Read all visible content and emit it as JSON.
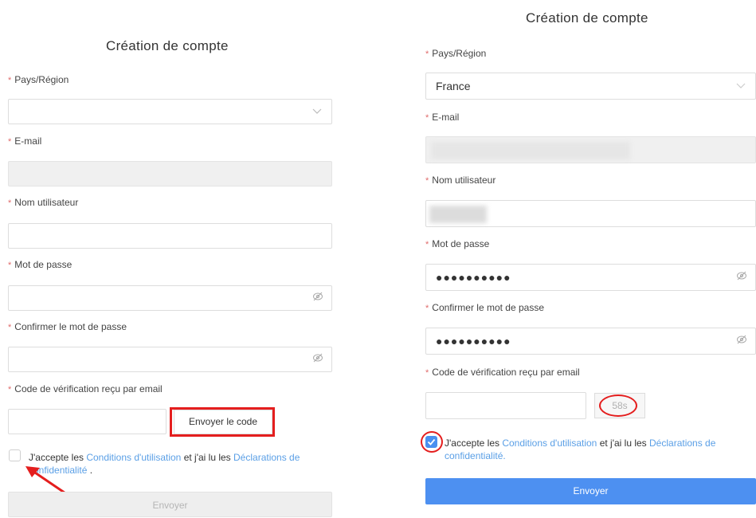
{
  "left": {
    "title": "Création de compte",
    "country_label": "Pays/Région",
    "country_value": "",
    "email_label": "E-mail",
    "username_label": "Nom utilisateur",
    "password_label": "Mot de passe",
    "confirm_label": "Confirmer le mot de passe",
    "code_label": "Code de vérification reçu par email",
    "send_code_button": "Envoyer le code",
    "terms_part1": "J'accepte les ",
    "terms_link1": "Conditions d'utilisation",
    "terms_part2": " et j'ai lu les ",
    "terms_link2": "Déclarations de confidentialité",
    "terms_end": " .",
    "submit_button": "Envoyer",
    "terms_checked": false
  },
  "right": {
    "title": "Création de compte",
    "country_label": "Pays/Région",
    "country_value": "France",
    "email_label": "E-mail",
    "username_label": "Nom utilisateur",
    "password_label": "Mot de passe",
    "password_value": "●●●●●●●●●●",
    "confirm_label": "Confirmer le mot de passe",
    "confirm_value": "●●●●●●●●●●",
    "code_label": "Code de vérification reçu par email",
    "countdown": "58s",
    "terms_part1": "J'accepte les ",
    "terms_link1": "Conditions d'utilisation",
    "terms_part2": " et j'ai lu les ",
    "terms_link2": "Déclarations de confidentialité",
    "terms_end": ".",
    "submit_button": "Envoyer",
    "terms_checked": true
  },
  "required_mark": "*",
  "icons": {
    "dropdown": "chevron-down-icon",
    "password_toggle": "eye-slash-icon",
    "check": "check-icon"
  },
  "colors": {
    "accent": "#4d90f1",
    "link": "#5a9fe6",
    "required": "#e06b6b",
    "highlight": "#e41e1e"
  }
}
